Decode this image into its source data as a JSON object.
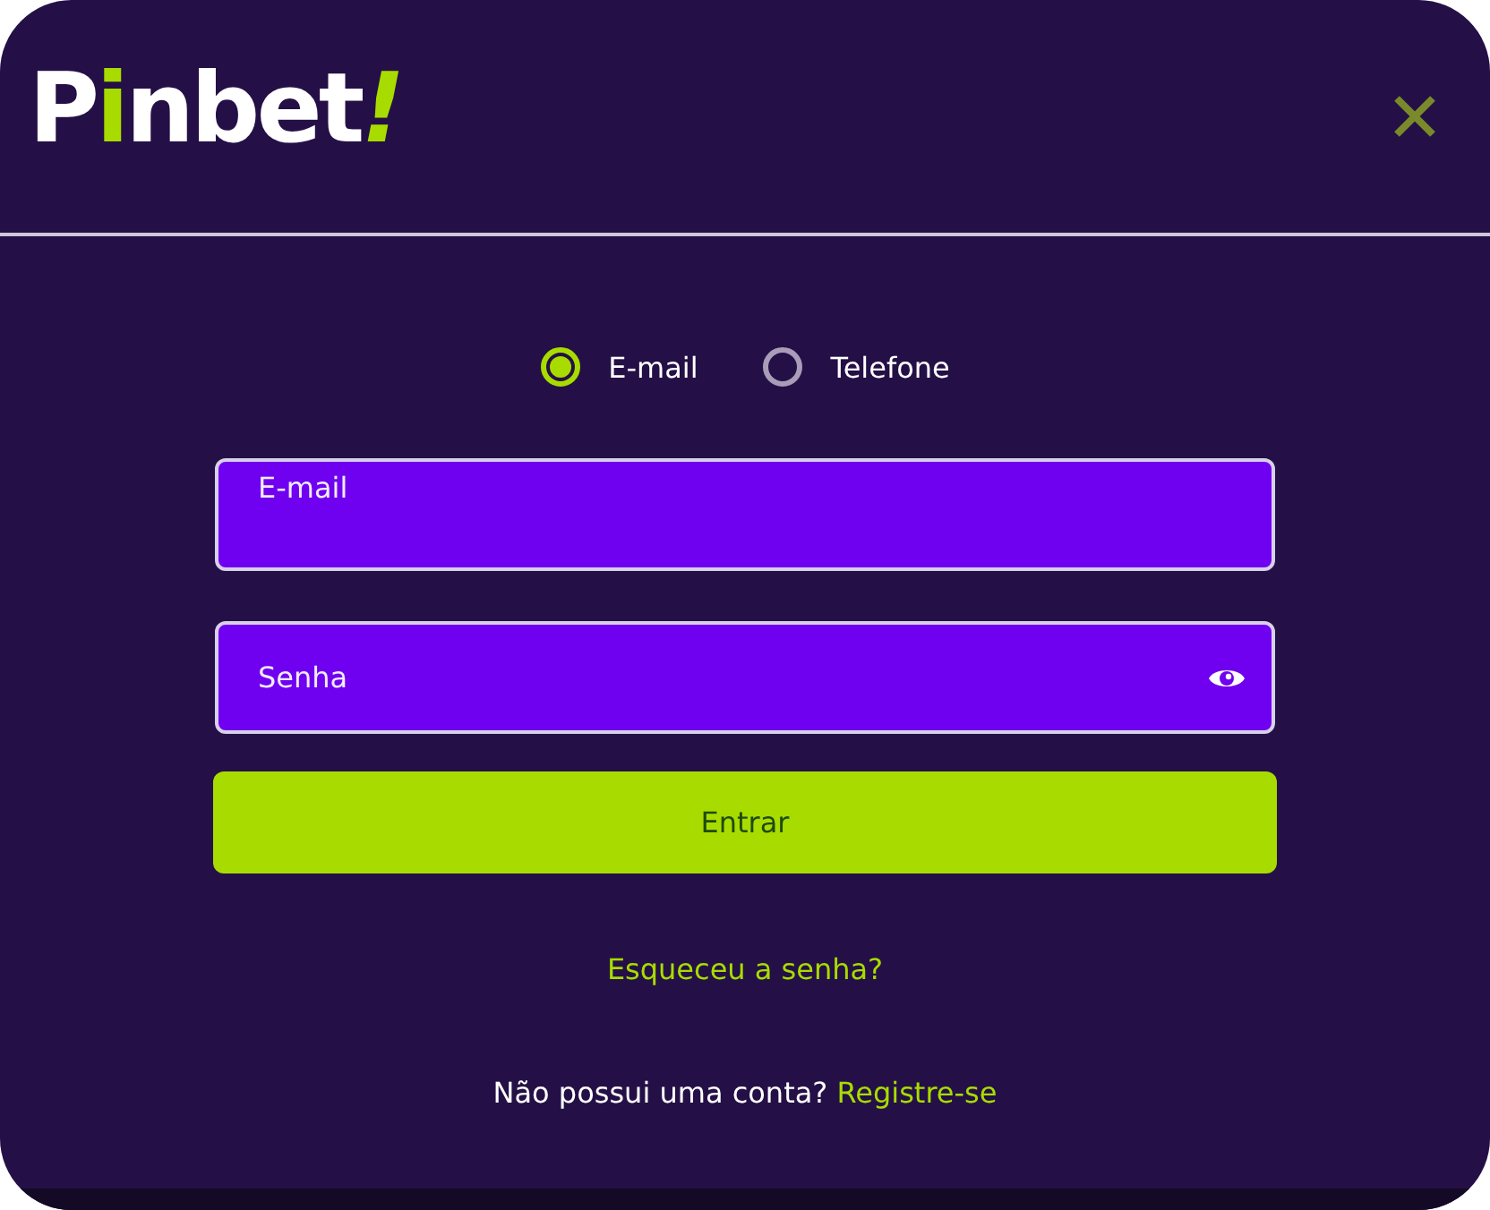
{
  "logo": {
    "parts": [
      {
        "text": "P",
        "accent": false
      },
      {
        "text": "i",
        "accent": true
      },
      {
        "text": "nbet",
        "accent": false
      },
      {
        "text": "!",
        "accent": true
      }
    ]
  },
  "login_method": [
    {
      "label": "E-mail",
      "selected": true
    },
    {
      "label": "Telefone",
      "selected": false
    }
  ],
  "email_field": {
    "label": "E-mail"
  },
  "password_field": {
    "placeholder": "Senha"
  },
  "submit_button": "Entrar",
  "forgot_link": "Esqueceu a senha?",
  "register": {
    "text": "Não possui uma conta?",
    "link": "Registre-se"
  }
}
